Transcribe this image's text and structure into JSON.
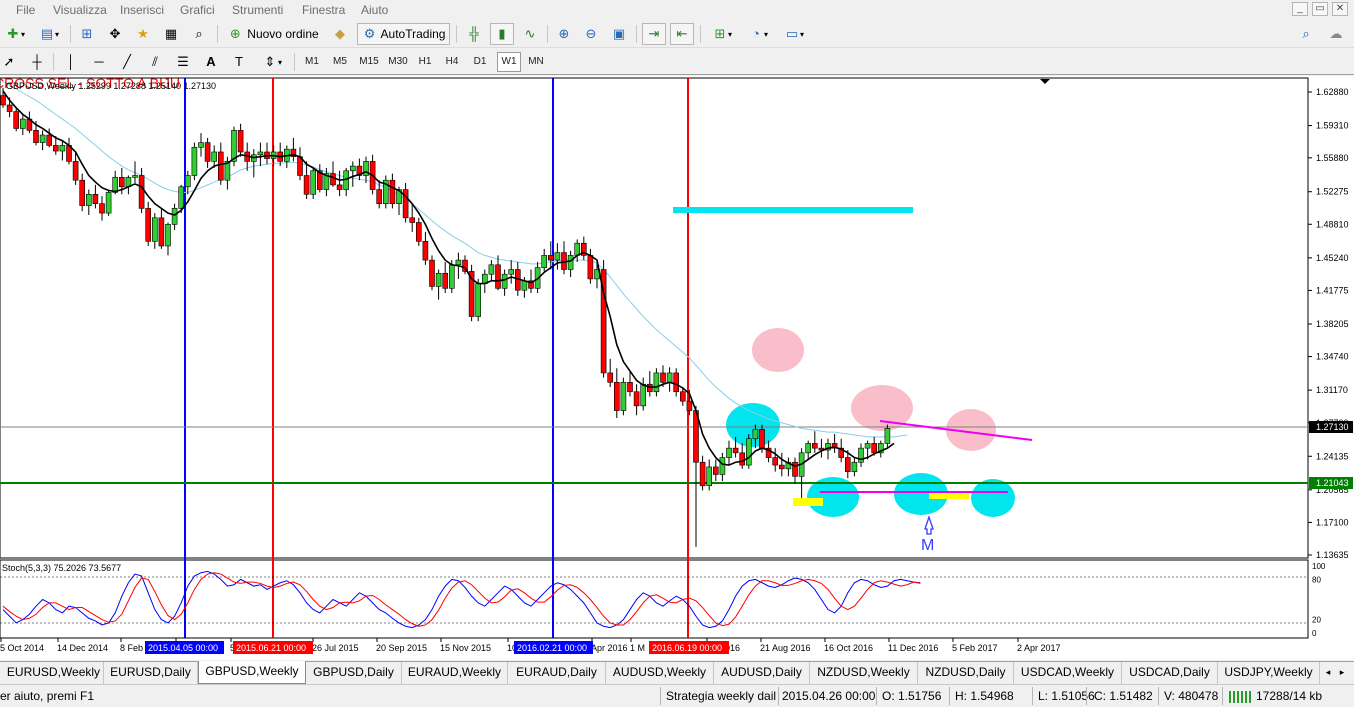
{
  "menu": [
    "File",
    "Visualizza",
    "Inserisci",
    "Grafici",
    "Strumenti",
    "Finestra",
    "Aiuto"
  ],
  "window_controls": [
    "_",
    "▭",
    "✕"
  ],
  "toolbar1": {
    "new_order_label": "Nuovo ordine",
    "autotrading_label": "AutoTrading"
  },
  "toolbar2": {
    "timeframes": [
      "M1",
      "M5",
      "M15",
      "M30",
      "H1",
      "H4",
      "D1",
      "W1",
      "MN"
    ],
    "active_timeframe": "W1"
  },
  "chart": {
    "header_text": "GBPUSD,Weekly  1.25299 1.27288 1.25140 1.27130",
    "overlay_text": "CROSS SEL - SOTTO A BIJU",
    "price_axis": [
      "1.62880",
      "1.59310",
      "1.55880",
      "1.52275",
      "1.48810",
      "1.45240",
      "1.41775",
      "1.38205",
      "1.34740",
      "1.31170",
      "1.27700",
      "1.24135",
      "1.20565",
      "1.17100",
      "1.13635"
    ],
    "current_price_label": "1.27130",
    "support_price_label": "1.21043",
    "date_axis": [
      "5 Oct 2014",
      "14 Dec 2014",
      "8 Feb",
      "15 Apr",
      "5",
      "26 Jul 2015",
      "20 Sep 2015",
      "15 Nov 2015",
      "10",
      "Apr 2016",
      "1 M",
      "Jul 2016",
      "21 Aug 2016",
      "16 Oct 2016",
      "11 Dec 2016",
      "5 Feb 2017",
      "2 Apr 2017"
    ],
    "vline_labels": [
      "2015.04.05 00:00",
      "2015.06.21 00:00",
      "2016.02.21 00:00",
      "2016.06.19 00:00"
    ],
    "marker_label": "M",
    "stoch_header": "Stoch(5,3,3) 75.2026 73.5677",
    "stoch_axis": [
      "100",
      "80",
      "20",
      "0"
    ],
    "colors": {
      "bull": "#32cd32",
      "bear": "#ff0000",
      "ma_fast": "#000000",
      "ma_slow": "#87ceeb",
      "stoch_main": "#0000ff",
      "stoch_signal": "#ff0000"
    },
    "candles": [
      [
        1.625,
        1.633,
        1.612,
        1.615
      ],
      [
        1.615,
        1.623,
        1.602,
        1.608
      ],
      [
        1.608,
        1.613,
        1.587,
        1.59
      ],
      [
        1.59,
        1.604,
        1.583,
        1.6
      ],
      [
        1.6,
        1.608,
        1.585,
        1.588
      ],
      [
        1.588,
        1.598,
        1.572,
        1.575
      ],
      [
        1.575,
        1.588,
        1.567,
        1.583
      ],
      [
        1.583,
        1.59,
        1.57,
        1.572
      ],
      [
        1.572,
        1.582,
        1.562,
        1.566
      ],
      [
        1.566,
        1.576,
        1.556,
        1.572
      ],
      [
        1.572,
        1.58,
        1.552,
        1.555
      ],
      [
        1.555,
        1.565,
        1.53,
        1.535
      ],
      [
        1.535,
        1.542,
        1.502,
        1.508
      ],
      [
        1.508,
        1.525,
        1.498,
        1.52
      ],
      [
        1.52,
        1.53,
        1.505,
        1.51
      ],
      [
        1.51,
        1.518,
        1.492,
        1.5
      ],
      [
        1.5,
        1.525,
        1.497,
        1.522
      ],
      [
        1.522,
        1.545,
        1.52,
        1.538
      ],
      [
        1.538,
        1.548,
        1.52,
        1.528
      ],
      [
        1.528,
        1.54,
        1.52,
        1.538
      ],
      [
        1.538,
        1.555,
        1.532,
        1.54
      ],
      [
        1.54,
        1.548,
        1.5,
        1.505
      ],
      [
        1.505,
        1.512,
        1.465,
        1.47
      ],
      [
        1.47,
        1.5,
        1.462,
        1.495
      ],
      [
        1.495,
        1.505,
        1.462,
        1.465
      ],
      [
        1.465,
        1.49,
        1.455,
        1.488
      ],
      [
        1.488,
        1.51,
        1.482,
        1.505
      ],
      [
        1.505,
        1.53,
        1.5,
        1.528
      ],
      [
        1.528,
        1.545,
        1.52,
        1.54
      ],
      [
        1.54,
        1.575,
        1.535,
        1.57
      ],
      [
        1.57,
        1.585,
        1.56,
        1.575
      ],
      [
        1.575,
        1.58,
        1.548,
        1.555
      ],
      [
        1.555,
        1.572,
        1.548,
        1.565
      ],
      [
        1.565,
        1.575,
        1.53,
        1.535
      ],
      [
        1.535,
        1.56,
        1.525,
        1.555
      ],
      [
        1.555,
        1.592,
        1.55,
        1.588
      ],
      [
        1.588,
        1.595,
        1.56,
        1.565
      ],
      [
        1.565,
        1.575,
        1.545,
        1.555
      ],
      [
        1.555,
        1.568,
        1.538,
        1.562
      ],
      [
        1.562,
        1.575,
        1.55,
        1.565
      ],
      [
        1.565,
        1.575,
        1.552,
        1.558
      ],
      [
        1.558,
        1.572,
        1.55,
        1.565
      ],
      [
        1.565,
        1.575,
        1.55,
        1.555
      ],
      [
        1.555,
        1.572,
        1.548,
        1.568
      ],
      [
        1.568,
        1.58,
        1.555,
        1.56
      ],
      [
        1.56,
        1.57,
        1.535,
        1.54
      ],
      [
        1.54,
        1.555,
        1.515,
        1.52
      ],
      [
        1.52,
        1.548,
        1.515,
        1.545
      ],
      [
        1.545,
        1.552,
        1.522,
        1.525
      ],
      [
        1.525,
        1.548,
        1.518,
        1.542
      ],
      [
        1.542,
        1.555,
        1.528,
        1.53
      ],
      [
        1.53,
        1.545,
        1.518,
        1.525
      ],
      [
        1.525,
        1.548,
        1.518,
        1.545
      ],
      [
        1.545,
        1.555,
        1.528,
        1.55
      ],
      [
        1.55,
        1.558,
        1.535,
        1.54
      ],
      [
        1.54,
        1.56,
        1.532,
        1.555
      ],
      [
        1.555,
        1.562,
        1.52,
        1.525
      ],
      [
        1.525,
        1.535,
        1.505,
        1.51
      ],
      [
        1.51,
        1.54,
        1.505,
        1.535
      ],
      [
        1.535,
        1.542,
        1.505,
        1.51
      ],
      [
        1.51,
        1.528,
        1.498,
        1.525
      ],
      [
        1.525,
        1.532,
        1.49,
        1.495
      ],
      [
        1.495,
        1.51,
        1.48,
        1.49
      ],
      [
        1.49,
        1.495,
        1.465,
        1.47
      ],
      [
        1.47,
        1.48,
        1.445,
        1.45
      ],
      [
        1.45,
        1.455,
        1.418,
        1.422
      ],
      [
        1.422,
        1.44,
        1.408,
        1.436
      ],
      [
        1.436,
        1.448,
        1.415,
        1.42
      ],
      [
        1.42,
        1.45,
        1.415,
        1.445
      ],
      [
        1.445,
        1.458,
        1.43,
        1.45
      ],
      [
        1.45,
        1.455,
        1.435,
        1.438
      ],
      [
        1.438,
        1.445,
        1.385,
        1.39
      ],
      [
        1.39,
        1.43,
        1.385,
        1.425
      ],
      [
        1.425,
        1.44,
        1.415,
        1.435
      ],
      [
        1.435,
        1.45,
        1.428,
        1.445
      ],
      [
        1.445,
        1.455,
        1.418,
        1.42
      ],
      [
        1.42,
        1.44,
        1.412,
        1.435
      ],
      [
        1.435,
        1.45,
        1.425,
        1.44
      ],
      [
        1.44,
        1.448,
        1.412,
        1.418
      ],
      [
        1.418,
        1.432,
        1.41,
        1.428
      ],
      [
        1.428,
        1.44,
        1.415,
        1.42
      ],
      [
        1.42,
        1.448,
        1.415,
        1.442
      ],
      [
        1.442,
        1.462,
        1.438,
        1.455
      ],
      [
        1.455,
        1.47,
        1.44,
        1.45
      ],
      [
        1.45,
        1.468,
        1.44,
        1.458
      ],
      [
        1.458,
        1.47,
        1.435,
        1.44
      ],
      [
        1.44,
        1.46,
        1.432,
        1.455
      ],
      [
        1.455,
        1.472,
        1.448,
        1.468
      ],
      [
        1.468,
        1.475,
        1.45,
        1.455
      ],
      [
        1.455,
        1.462,
        1.425,
        1.43
      ],
      [
        1.43,
        1.448,
        1.42,
        1.44
      ],
      [
        1.44,
        1.45,
        1.325,
        1.33
      ],
      [
        1.33,
        1.345,
        1.315,
        1.32
      ],
      [
        1.32,
        1.335,
        1.282,
        1.29
      ],
      [
        1.29,
        1.325,
        1.285,
        1.32
      ],
      [
        1.32,
        1.332,
        1.305,
        1.31
      ],
      [
        1.31,
        1.318,
        1.285,
        1.295
      ],
      [
        1.295,
        1.325,
        1.29,
        1.318
      ],
      [
        1.318,
        1.332,
        1.305,
        1.31
      ],
      [
        1.31,
        1.335,
        1.305,
        1.33
      ],
      [
        1.33,
        1.338,
        1.315,
        1.32
      ],
      [
        1.32,
        1.336,
        1.31,
        1.33
      ],
      [
        1.33,
        1.335,
        1.305,
        1.31
      ],
      [
        1.31,
        1.315,
        1.295,
        1.3
      ],
      [
        1.3,
        1.312,
        1.285,
        1.29
      ],
      [
        1.29,
        1.295,
        1.145,
        1.235
      ],
      [
        1.235,
        1.242,
        1.205,
        1.21
      ],
      [
        1.21,
        1.238,
        1.205,
        1.23
      ],
      [
        1.23,
        1.238,
        1.215,
        1.222
      ],
      [
        1.222,
        1.245,
        1.215,
        1.24
      ],
      [
        1.24,
        1.258,
        1.232,
        1.25
      ],
      [
        1.25,
        1.262,
        1.24,
        1.245
      ],
      [
        1.245,
        1.255,
        1.228,
        1.232
      ],
      [
        1.232,
        1.265,
        1.228,
        1.26
      ],
      [
        1.26,
        1.275,
        1.25,
        1.27
      ],
      [
        1.27,
        1.275,
        1.245,
        1.25
      ],
      [
        1.25,
        1.258,
        1.235,
        1.24
      ],
      [
        1.24,
        1.25,
        1.225,
        1.232
      ],
      [
        1.232,
        1.245,
        1.22,
        1.228
      ],
      [
        1.228,
        1.24,
        1.22,
        1.235
      ],
      [
        1.235,
        1.24,
        1.212,
        1.22
      ],
      [
        1.22,
        1.25,
        1.197,
        1.245
      ],
      [
        1.245,
        1.258,
        1.238,
        1.255
      ],
      [
        1.255,
        1.268,
        1.245,
        1.25
      ],
      [
        1.25,
        1.26,
        1.24,
        1.248
      ],
      [
        1.248,
        1.26,
        1.238,
        1.255
      ],
      [
        1.255,
        1.265,
        1.245,
        1.25
      ],
      [
        1.25,
        1.26,
        1.235,
        1.24
      ],
      [
        1.24,
        1.248,
        1.218,
        1.225
      ],
      [
        1.225,
        1.24,
        1.22,
        1.235
      ],
      [
        1.235,
        1.255,
        1.23,
        1.25
      ],
      [
        1.25,
        1.258,
        1.238,
        1.255
      ],
      [
        1.255,
        1.262,
        1.242,
        1.245
      ],
      [
        1.245,
        1.258,
        1.24,
        1.255
      ],
      [
        1.255,
        1.275,
        1.251,
        1.271
      ]
    ],
    "ma_fast": [
      1.63,
      1.62,
      1.612,
      1.605,
      1.6,
      1.594,
      1.59,
      1.585,
      1.58,
      1.577,
      1.572,
      1.565,
      1.552,
      1.54,
      1.533,
      1.527,
      1.524,
      1.523,
      1.525,
      1.528,
      1.531,
      1.528,
      1.518,
      1.51,
      1.505,
      1.5,
      1.498,
      1.503,
      1.512,
      1.524,
      1.537,
      1.545,
      1.55,
      1.552,
      1.553,
      1.558,
      1.562,
      1.561,
      1.559,
      1.56,
      1.561,
      1.561,
      1.56,
      1.561,
      1.562,
      1.56,
      1.552,
      1.548,
      1.543,
      1.54,
      1.538,
      1.535,
      1.536,
      1.539,
      1.541,
      1.544,
      1.54,
      1.533,
      1.531,
      1.527,
      1.524,
      1.518,
      1.51,
      1.5,
      1.488,
      1.473,
      1.46,
      1.45,
      1.445,
      1.444,
      1.442,
      1.43,
      1.425,
      1.425,
      1.428,
      1.428,
      1.429,
      1.432,
      1.43,
      1.428,
      1.426,
      1.43,
      1.437,
      1.442,
      1.447,
      1.448,
      1.449,
      1.455,
      1.458,
      1.455,
      1.45,
      1.415,
      1.39,
      1.36,
      1.342,
      1.332,
      1.322,
      1.317,
      1.315,
      1.315,
      1.318,
      1.32,
      1.318,
      1.314,
      1.308,
      1.29,
      1.265,
      1.25,
      1.24,
      1.233,
      1.232,
      1.235,
      1.236,
      1.24,
      1.247,
      1.25,
      1.248,
      1.244,
      1.238,
      1.234,
      1.231,
      1.233,
      1.238,
      1.243,
      1.247,
      1.25,
      1.251,
      1.249,
      1.245,
      1.24,
      1.238,
      1.24,
      1.244,
      1.247,
      1.25,
      1.255
    ],
    "ma_slow": [
      1.64,
      1.636,
      1.632,
      1.628,
      1.624,
      1.62,
      1.615,
      1.61,
      1.605,
      1.6,
      1.595,
      1.59,
      1.584,
      1.578,
      1.572,
      1.566,
      1.56,
      1.555,
      1.55,
      1.546,
      1.543,
      1.54,
      1.536,
      1.532,
      1.528,
      1.525,
      1.523,
      1.522,
      1.522,
      1.524,
      1.527,
      1.53,
      1.533,
      1.536,
      1.538,
      1.542,
      1.546,
      1.548,
      1.55,
      1.551,
      1.552,
      1.553,
      1.553,
      1.554,
      1.554,
      1.553,
      1.551,
      1.549,
      1.546,
      1.544,
      1.542,
      1.54,
      1.538,
      1.537,
      1.536,
      1.535,
      1.533,
      1.53,
      1.527,
      1.523,
      1.519,
      1.515,
      1.51,
      1.504,
      1.498,
      1.492,
      1.486,
      1.481,
      1.476,
      1.472,
      1.468,
      1.463,
      1.458,
      1.455,
      1.453,
      1.451,
      1.45,
      1.449,
      1.448,
      1.447,
      1.446,
      1.446,
      1.447,
      1.448,
      1.449,
      1.45,
      1.45,
      1.45,
      1.45,
      1.449,
      1.447,
      1.44,
      1.432,
      1.423,
      1.414,
      1.406,
      1.398,
      1.39,
      1.383,
      1.376,
      1.37,
      1.364,
      1.358,
      1.352,
      1.346,
      1.338,
      1.33,
      1.322,
      1.315,
      1.309,
      1.303,
      1.298,
      1.294,
      1.29,
      1.287,
      1.284,
      1.281,
      1.279,
      1.277,
      1.275,
      1.273,
      1.271,
      1.27,
      1.269,
      1.268,
      1.267,
      1.267,
      1.266,
      1.265,
      1.264,
      1.263,
      1.262,
      1.262,
      1.262,
      1.262,
      1.262,
      1.263,
      1.264
    ],
    "stoch_main": [
      35,
      25,
      15,
      20,
      28,
      40,
      50,
      45,
      35,
      30,
      40,
      38,
      30,
      22,
      18,
      12,
      15,
      30,
      55,
      75,
      88,
      85,
      60,
      35,
      20,
      15,
      25,
      45,
      70,
      85,
      90,
      92,
      88,
      80,
      70,
      72,
      80,
      75,
      70,
      72,
      65,
      70,
      75,
      78,
      72,
      60,
      45,
      35,
      30,
      40,
      50,
      45,
      40,
      50,
      60,
      55,
      45,
      35,
      30,
      22,
      15,
      10,
      8,
      12,
      20,
      35,
      55,
      70,
      80,
      78,
      68,
      55,
      45,
      40,
      50,
      60,
      70,
      65,
      55,
      45,
      40,
      50,
      60,
      70,
      75,
      72,
      65,
      55,
      45,
      30,
      15,
      10,
      8,
      12,
      20,
      35,
      50,
      60,
      55,
      45,
      40,
      48,
      55,
      50,
      40,
      25,
      12,
      8,
      10,
      18,
      35,
      55,
      70,
      78,
      80,
      75,
      70,
      68,
      72,
      78,
      82,
      80,
      75,
      65,
      50,
      35,
      30,
      40,
      60,
      75,
      80,
      78,
      72,
      68,
      70,
      78,
      80,
      78,
      76,
      75
    ],
    "stoch_signal": [
      40,
      32,
      25,
      20,
      22,
      28,
      38,
      45,
      45,
      40,
      35,
      38,
      38,
      32,
      26,
      20,
      16,
      18,
      28,
      48,
      68,
      82,
      80,
      62,
      42,
      26,
      20,
      28,
      45,
      65,
      80,
      88,
      90,
      88,
      82,
      76,
      74,
      76,
      76,
      74,
      70,
      68,
      70,
      74,
      76,
      72,
      62,
      50,
      40,
      35,
      38,
      45,
      46,
      45,
      48,
      55,
      56,
      50,
      42,
      35,
      28,
      20,
      14,
      10,
      12,
      20,
      34,
      52,
      67,
      76,
      78,
      72,
      62,
      52,
      45,
      46,
      54,
      64,
      66,
      60,
      52,
      46,
      46,
      54,
      64,
      71,
      72,
      68,
      60,
      50,
      38,
      25,
      15,
      12,
      12,
      20,
      32,
      45,
      55,
      57,
      52,
      46,
      45,
      50,
      52,
      48,
      38,
      26,
      15,
      11,
      13,
      24,
      40,
      57,
      70,
      78,
      78,
      75,
      71,
      71,
      74,
      78,
      80,
      78,
      74,
      65,
      52,
      40,
      35,
      40,
      52,
      65,
      75,
      78,
      76,
      73,
      70,
      72,
      76,
      74
    ]
  },
  "symbol_tabs": [
    "EURUSD,Weekly",
    "EURUSD,Daily",
    "GBPUSD,Weekly",
    "GBPUSD,Daily",
    "EURAUD,Weekly",
    "EURAUD,Daily",
    "AUDUSD,Weekly",
    "AUDUSD,Daily",
    "NZDUSD,Weekly",
    "NZDUSD,Daily",
    "USDCAD,Weekly",
    "USDCAD,Daily",
    "USDJPY,Weekly"
  ],
  "active_tab": "GBPUSD,Weekly",
  "status": {
    "help": "er aiuto, premi F1",
    "profile": "Strategia weekly dail",
    "datetime": "2015.04.26 00:00",
    "open": "O: 1.51756",
    "high": "H: 1.54968",
    "low": "L: 1.51056",
    "close": "C: 1.51482",
    "volume": "V: 480478",
    "traffic": "17288/14 kb"
  }
}
